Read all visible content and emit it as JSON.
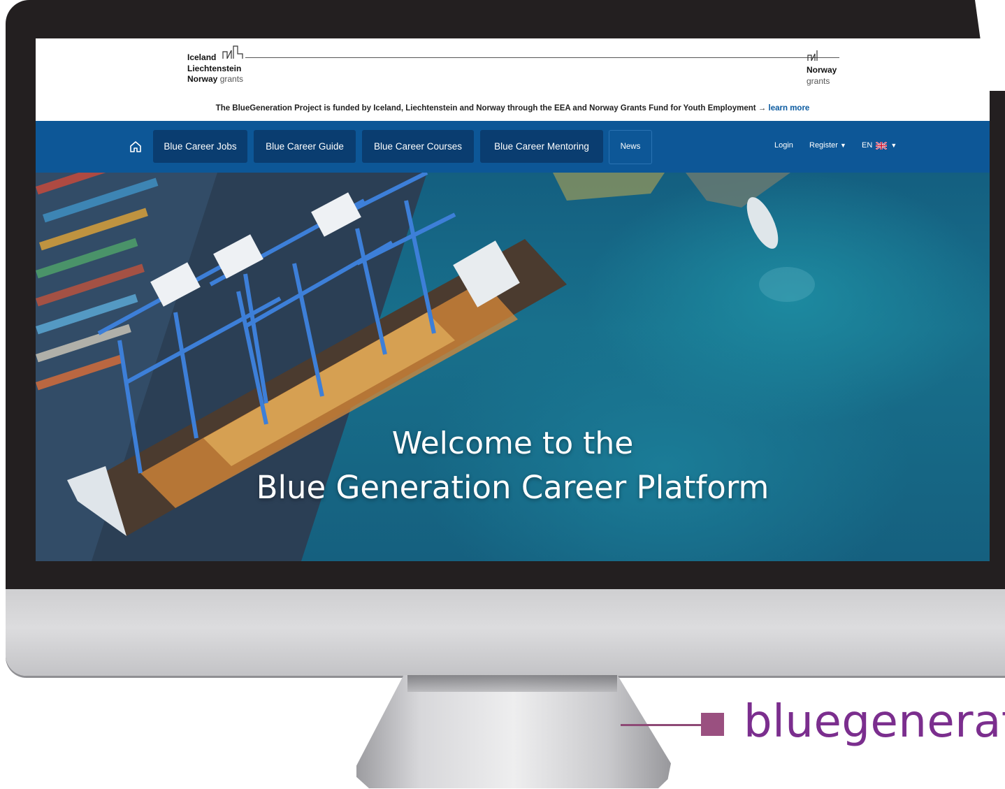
{
  "eea": {
    "left_logo": {
      "line1": "Iceland",
      "line2": "Liechtenstein",
      "line3": "Norway",
      "line3_suffix": "grants"
    },
    "right_logo": {
      "line1": "Norway",
      "line2": "grants"
    },
    "funding_text": "The BlueGeneration Project is funded by Iceland, Liechtenstein and Norway through the EEA and Norway Grants Fund for Youth Employment →",
    "learn_more": "learn more"
  },
  "nav": {
    "home_icon": "home-icon",
    "items": [
      {
        "label": "Blue Career Jobs"
      },
      {
        "label": "Blue Career Guide"
      },
      {
        "label": "Blue Career Courses"
      },
      {
        "label": "Blue Career Mentoring"
      },
      {
        "label": "News"
      }
    ],
    "login": "Login",
    "register": "Register",
    "language": "EN",
    "language_flag": "uk-flag-icon"
  },
  "hero": {
    "line1": "Welcome to the",
    "line2": "Blue Generation Career Platform"
  },
  "caption": "bluegenerat",
  "colors": {
    "nav_bg": "#0d5797",
    "nav_item_bg": "#0a3d70",
    "caption": "#7b2e8e",
    "link": "#0a5aa0"
  }
}
